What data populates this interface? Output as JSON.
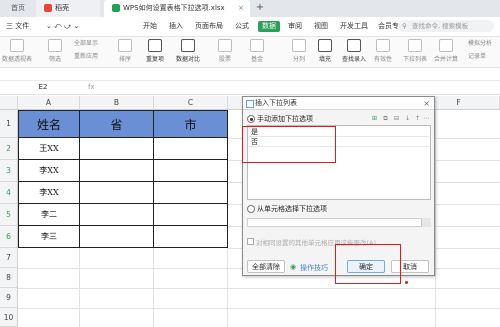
{
  "tabs": {
    "home": "首页",
    "daoke": "稻壳",
    "doc": "WPS如何设置表格下拉选项.xlsx",
    "close": "×",
    "new_tab": "+"
  },
  "menu": {
    "file": "三 文件",
    "items": [
      "开始",
      "插入",
      "页面布局",
      "公式",
      "数据",
      "审阅",
      "视图",
      "开发工具",
      "会员专享"
    ],
    "active_index": 4,
    "search_placeholder": "查找命令, 搜索模板"
  },
  "toolbar": {
    "tools": [
      "数据透视表",
      "筛选",
      "全部显示",
      "排序",
      "重复项",
      "数据对比",
      "股票",
      "基金",
      "分列",
      "填充",
      "查找录入",
      "有效性",
      "下拉列表",
      "合并计算",
      "模拟分析",
      "记录单"
    ],
    "reapply": "重新应用"
  },
  "formula_bar": {
    "cell_ref": "E2",
    "fx": "fx"
  },
  "grid": {
    "columns": [
      "A",
      "B",
      "C",
      "D",
      "E",
      "F"
    ],
    "rows": [
      "1",
      "2",
      "3",
      "4",
      "5",
      "6",
      "7",
      "8",
      "9",
      "10"
    ],
    "header": [
      "姓名",
      "省",
      "市"
    ],
    "names": [
      "王XX",
      "李XX",
      "李XX",
      "李二",
      "李三"
    ]
  },
  "dialog": {
    "title": "插入下拉列表",
    "close": "×",
    "manual_option": "手动添加下拉选项",
    "options": [
      "是",
      "否"
    ],
    "cell_option": "从单元格选择下拉选项",
    "multi_option": "对相同设置的其他单元格应用这些更改(A)",
    "clear_all": "全部清除",
    "tips": "操作技巧",
    "confirm": "确定",
    "cancel": "取消",
    "accent": "#e01b1b"
  }
}
